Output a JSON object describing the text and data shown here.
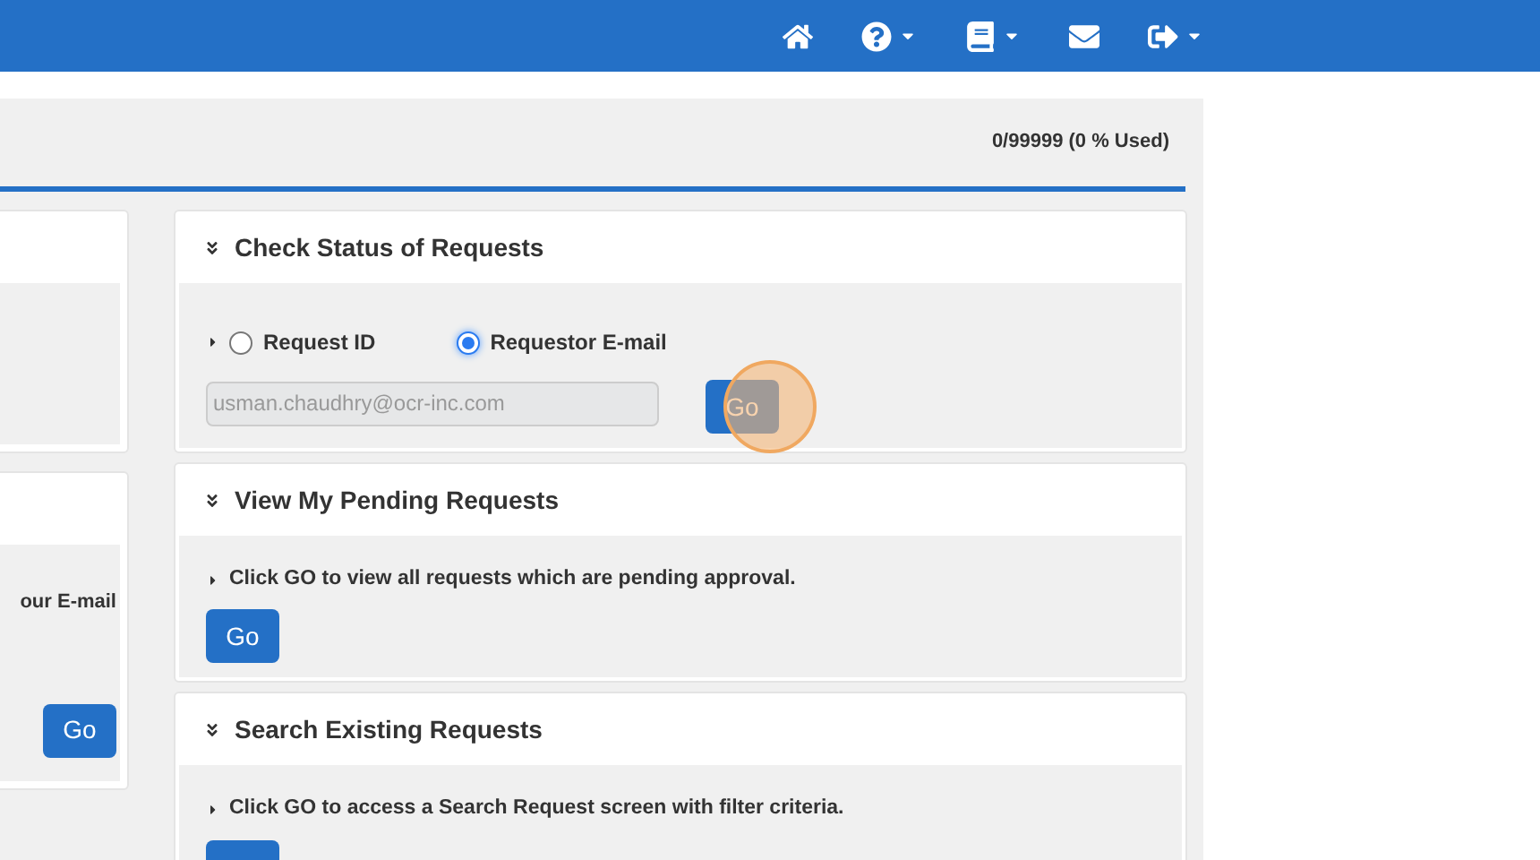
{
  "navbar": {
    "items": [
      {
        "kind": "home",
        "caret": false
      },
      {
        "kind": "help",
        "caret": true
      },
      {
        "kind": "book",
        "caret": true
      },
      {
        "kind": "mail",
        "caret": false
      },
      {
        "kind": "logout",
        "caret": true
      }
    ]
  },
  "usage": "0/99999 (0 % Used)",
  "left_cards": [
    {
      "kind": "blank"
    },
    {
      "kind": "action",
      "body": "our E-mail",
      "button": "Go"
    }
  ],
  "panels": [
    {
      "title": "Check Status of Requests",
      "kind": "status",
      "options": [
        {
          "label": "Request ID",
          "selected": false
        },
        {
          "label": "Requestor E-mail",
          "selected": true
        }
      ],
      "email_value": "usman.chaudhry@ocr-inc.com",
      "button": "Go"
    },
    {
      "title": "View My Pending Requests",
      "kind": "info",
      "text": "Click GO to view all requests which are pending approval.",
      "button": "Go"
    },
    {
      "title": "Search Existing Requests",
      "kind": "info",
      "text": "Click GO to access a Search Request screen with filter criteria."
    }
  ]
}
